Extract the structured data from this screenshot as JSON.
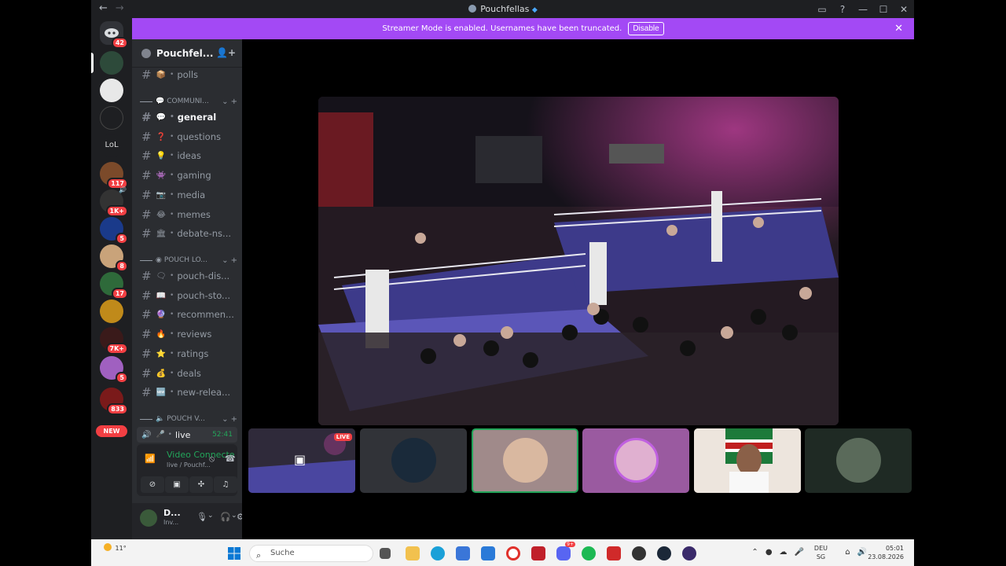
{
  "window": {
    "title": "Pouchfellas",
    "back": "←",
    "forward": "→"
  },
  "banner": {
    "text": "Streamer Mode is enabled. Usernames have been truncated.",
    "button": "Disable",
    "close": "✕"
  },
  "rail": {
    "badges": [
      "42",
      "117",
      "1K+",
      "5",
      "8",
      "17",
      "7K+",
      "5",
      "833"
    ],
    "new_label": "NEW",
    "lol_label": "LoL"
  },
  "guild": {
    "name": "Pouchfel...",
    "chevron": "⌄"
  },
  "channels_top": [
    {
      "name": "polls",
      "emoji": "📦"
    }
  ],
  "categories": [
    {
      "name": "COMMUNI..."
    },
    {
      "name": "POUCH LO..."
    },
    {
      "name": "POUCH V..."
    }
  ],
  "community_channels": [
    {
      "name": "general",
      "emoji": "💬"
    },
    {
      "name": "questions",
      "emoji": "❓"
    },
    {
      "name": "ideas",
      "emoji": "💡"
    },
    {
      "name": "gaming",
      "emoji": "👾"
    },
    {
      "name": "media",
      "emoji": "📷"
    },
    {
      "name": "memes",
      "emoji": "😂"
    },
    {
      "name": "debate-ns...",
      "emoji": "🏛"
    }
  ],
  "lounge_channels": [
    {
      "name": "pouch-dis...",
      "emoji": "🗨"
    },
    {
      "name": "pouch-sto...",
      "emoji": "📖"
    },
    {
      "name": "recommen...",
      "emoji": "🔮"
    },
    {
      "name": "reviews",
      "emoji": "🔥"
    },
    {
      "name": "ratings",
      "emoji": "⭐"
    },
    {
      "name": "deals",
      "emoji": "💰"
    },
    {
      "name": "new-relea...",
      "emoji": "🆕"
    }
  ],
  "voice": {
    "channel": "live",
    "timer": "52:41",
    "status": "Video Connecte",
    "location": "live / Pouchf..."
  },
  "user": {
    "name": "D...",
    "status": "Inv..."
  },
  "stage": {
    "live_badge": "LIVE"
  },
  "taskbar": {
    "temperature": "11°",
    "search_placeholder": "Suche",
    "lang_top": "DEU",
    "lang_bottom": "SG",
    "time": "05:01",
    "date": "23.08.2026",
    "discord_badge": "9+"
  },
  "colors": {
    "accent": "#a349f5",
    "green": "#23a55a",
    "red": "#f23f43"
  }
}
